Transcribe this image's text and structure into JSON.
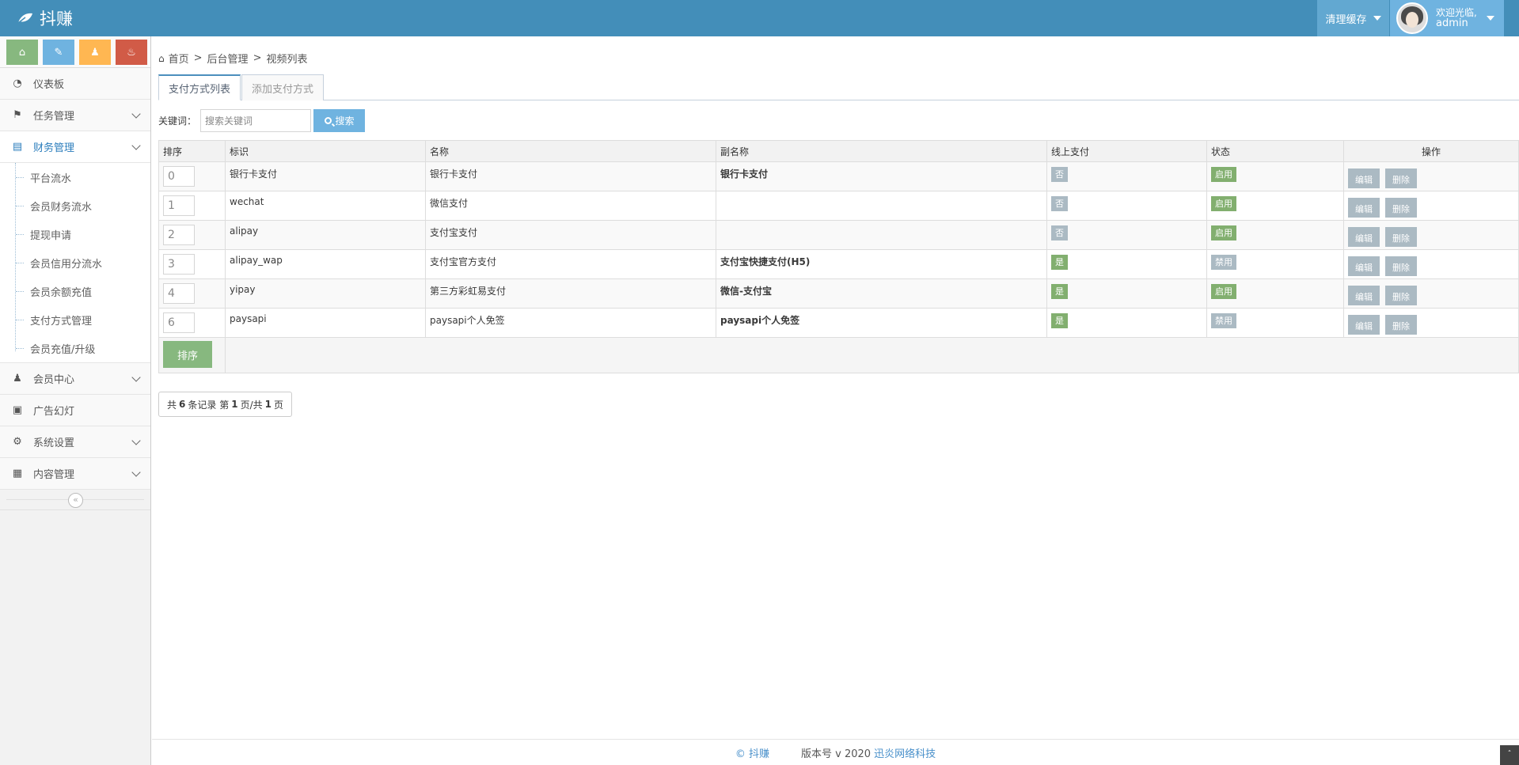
{
  "app": {
    "brand": "抖赚"
  },
  "navbar": {
    "clear_cache": "清理缓存",
    "welcome": "欢迎光临,",
    "username": "admin"
  },
  "shortcuts": [
    {
      "icon": "home-icon",
      "color": "#87b87f"
    },
    {
      "icon": "pencil-icon",
      "color": "#6fb3e0"
    },
    {
      "icon": "users-icon",
      "color": "#ffb752"
    },
    {
      "icon": "bell-icon",
      "color": "#d15b47"
    }
  ],
  "sidebar": {
    "items": [
      {
        "label": "仪表板",
        "icon": "dashboard-icon"
      },
      {
        "label": "任务管理",
        "icon": "flag-icon"
      },
      {
        "label": "财务管理",
        "icon": "wallet-icon"
      },
      {
        "label": "会员中心",
        "icon": "user-icon"
      },
      {
        "label": "广告幻灯",
        "icon": "picture-icon"
      },
      {
        "label": "系统设置",
        "icon": "gear-icon"
      },
      {
        "label": "内容管理",
        "icon": "book-icon"
      }
    ],
    "finance_sub": [
      "平台流水",
      "会员财务流水",
      "提现申请",
      "会员信用分流水",
      "会员余额充值",
      "支付方式管理",
      "会员充值/升级"
    ]
  },
  "breadcrumb": {
    "home": "首页",
    "level1": "后台管理",
    "level2": "视频列表"
  },
  "tabs": {
    "list": "支付方式列表",
    "add": "添加支付方式"
  },
  "search": {
    "label": "关键词：",
    "placeholder": "搜索关键词",
    "button": "搜索"
  },
  "table": {
    "headers": [
      "排序",
      "标识",
      "名称",
      "副名称",
      "线上支付",
      "状态",
      "操作"
    ],
    "rows": [
      {
        "sort": "0",
        "code": "银行卡支付",
        "name": "银行卡支付",
        "subname": "银行卡支付",
        "online": "否",
        "status": "启用"
      },
      {
        "sort": "1",
        "code": "wechat",
        "name": "微信支付",
        "subname": "",
        "online": "否",
        "status": "启用"
      },
      {
        "sort": "2",
        "code": "alipay",
        "name": "支付宝支付",
        "subname": "",
        "online": "否",
        "status": "启用"
      },
      {
        "sort": "3",
        "code": "alipay_wap",
        "name": "支付宝官方支付",
        "subname": "支付宝快捷支付(H5)",
        "online": "是",
        "status": "禁用"
      },
      {
        "sort": "4",
        "code": "yipay",
        "name": "第三方彩虹易支付",
        "subname": "微信-支付宝",
        "online": "是",
        "status": "启用"
      },
      {
        "sort": "6",
        "code": "paysapi",
        "name": "paysapi个人免签",
        "subname": "paysapi个人免签",
        "online": "是",
        "status": "禁用"
      }
    ],
    "edit_label": "编辑",
    "delete_label": "删除",
    "sort_button": "排序"
  },
  "pager": {
    "prefix": "共",
    "total": "6",
    "mid1": "条记录 第",
    "page": "1",
    "mid2": "页/共",
    "pages": "1",
    "suffix": "页"
  },
  "footer": {
    "brand": "© 抖赚",
    "version": "版本号 v 2020",
    "company": "迅炎网络科技"
  },
  "colors": {
    "navbar": "#438eb9",
    "online_yes": "#82af6f",
    "online_no": "#abbac3",
    "status_on": "#82af6f",
    "status_off": "#abbac3"
  }
}
